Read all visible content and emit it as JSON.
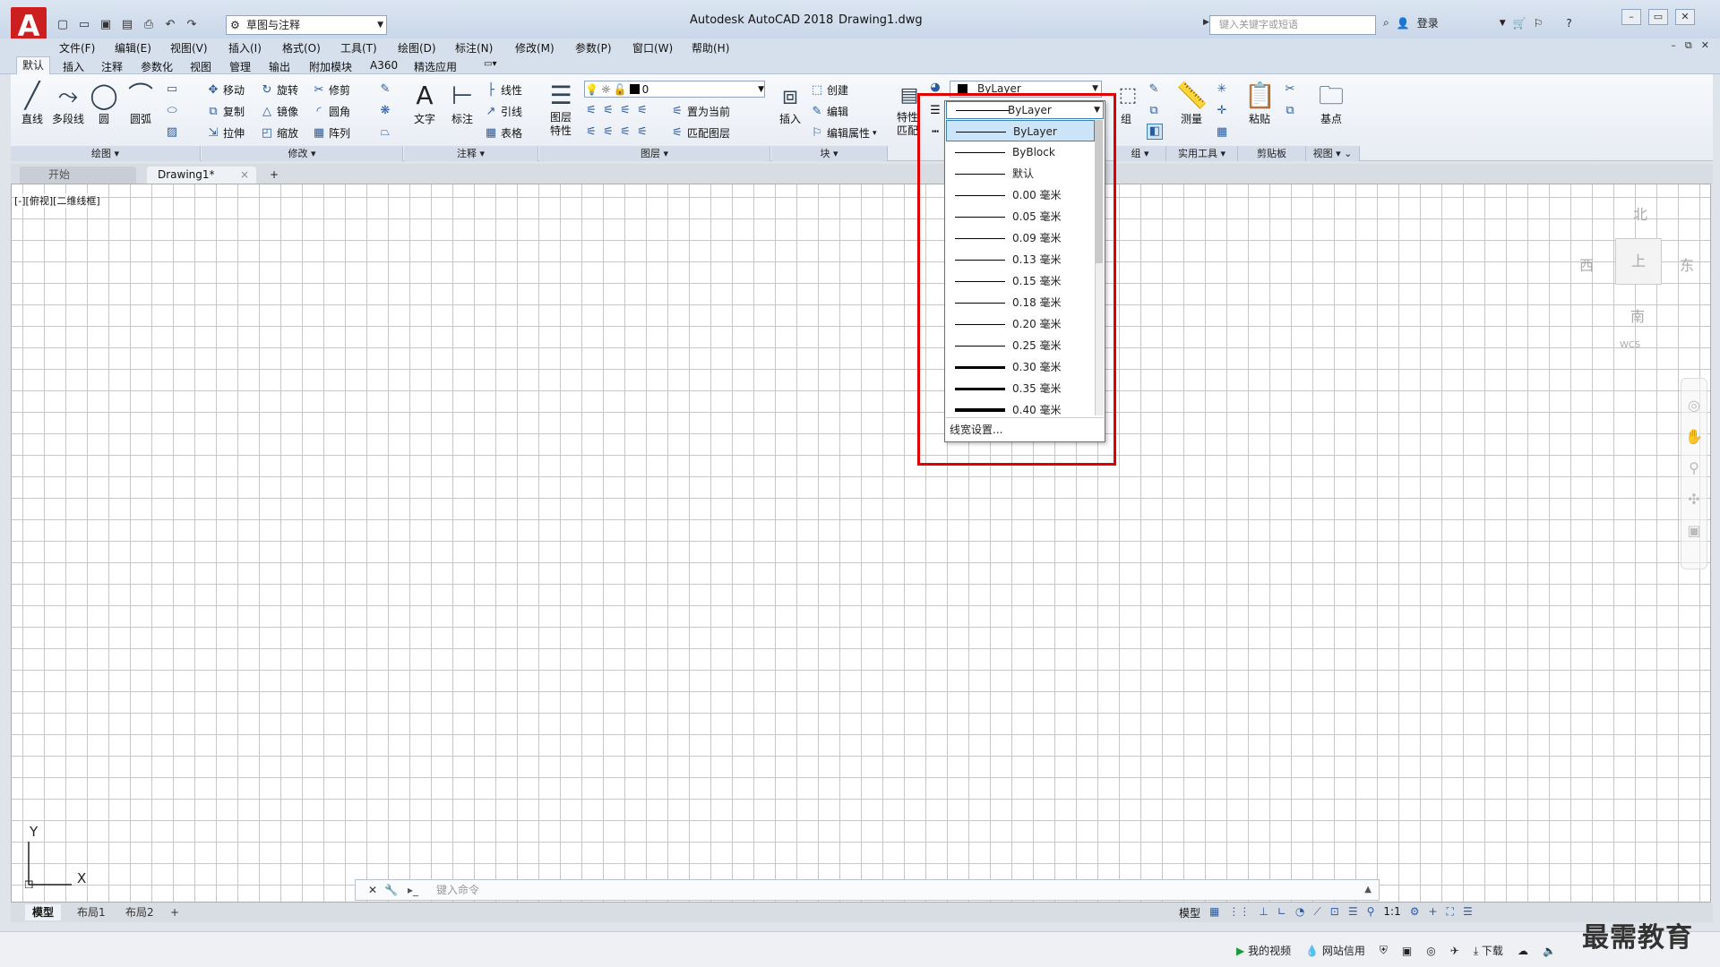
{
  "window": {
    "app_title": "Autodesk AutoCAD 2018",
    "doc_name": "Drawing1.dwg",
    "logo_letter": "A"
  },
  "workspace": {
    "value": "草图与注释"
  },
  "search": {
    "placeholder": "键入关键字或短语",
    "login": "登录"
  },
  "menu": [
    "文件(F)",
    "编辑(E)",
    "视图(V)",
    "插入(I)",
    "格式(O)",
    "工具(T)",
    "绘图(D)",
    "标注(N)",
    "修改(M)",
    "参数(P)",
    "窗口(W)",
    "帮助(H)"
  ],
  "ribbon_tabs": [
    "默认",
    "插入",
    "注释",
    "参数化",
    "视图",
    "管理",
    "输出",
    "附加模块",
    "A360",
    "精选应用"
  ],
  "panels": {
    "draw": {
      "title": "绘图",
      "tools": [
        "直线",
        "多段线",
        "圆",
        "圆弧"
      ]
    },
    "modify": {
      "title": "修改",
      "tools": [
        "移动",
        "旋转",
        "修剪",
        "复制",
        "镜像",
        "圆角",
        "拉伸",
        "缩放",
        "阵列"
      ]
    },
    "annotation": {
      "title": "注释",
      "tools": [
        "文字",
        "标注",
        "线性",
        "引线",
        "表格"
      ]
    },
    "layers": {
      "title": "图层",
      "tools": [
        "图层特性",
        "置为当前",
        "匹配图层"
      ],
      "layer_value": "0"
    },
    "block": {
      "title": "块",
      "tools": [
        "插入",
        "创建",
        "编辑",
        "编辑属性"
      ]
    },
    "properties": {
      "tools": [
        "特性",
        "匹配"
      ],
      "color_value": "ByLayer"
    },
    "groups": {
      "title": "组",
      "tools": [
        "组"
      ]
    },
    "utilities": {
      "title": "实用工具",
      "tools": [
        "测量"
      ]
    },
    "clipboard": {
      "title": "剪贴板",
      "tools": [
        "粘贴"
      ]
    },
    "view": {
      "title": "视图",
      "tools": [
        "基点"
      ]
    }
  },
  "doc_tabs": [
    "开始",
    "Drawing1*"
  ],
  "viewport_label": "[-][俯视][二维线框]",
  "viewcube": {
    "n": "北",
    "s": "南",
    "e": "东",
    "w": "西",
    "top": "上",
    "wcs": "WCS"
  },
  "ucs": {
    "x": "X",
    "y": "Y"
  },
  "command": {
    "placeholder": "键入命令"
  },
  "layout_tabs": [
    "模型",
    "布局1",
    "布局2"
  ],
  "status": {
    "model": "模型",
    "scale": "1:1"
  },
  "lineweight_dropdown": {
    "current": "ByLayer",
    "items": [
      {
        "label": "ByLayer",
        "weight": 1,
        "selected": true
      },
      {
        "label": "ByBlock",
        "weight": 1
      },
      {
        "label": "默认",
        "weight": 1
      },
      {
        "label": "0.00 毫米",
        "weight": 1
      },
      {
        "label": "0.05 毫米",
        "weight": 1
      },
      {
        "label": "0.09 毫米",
        "weight": 1
      },
      {
        "label": "0.13 毫米",
        "weight": 1
      },
      {
        "label": "0.15 毫米",
        "weight": 1
      },
      {
        "label": "0.18 毫米",
        "weight": 1
      },
      {
        "label": "0.20 毫米",
        "weight": 1
      },
      {
        "label": "0.25 毫米",
        "weight": 1
      },
      {
        "label": "0.30 毫米",
        "weight": 3
      },
      {
        "label": "0.35 毫米",
        "weight": 3
      },
      {
        "label": "0.40 毫米",
        "weight": 4
      }
    ],
    "footer": "线宽设置..."
  },
  "taskbar": {
    "items": [
      "我的视频",
      "网站信用",
      "下载"
    ]
  },
  "watermark": "最需教育",
  "colors": {
    "highlight": "#e00000",
    "selection": "#cce4f7",
    "logo": "#cc1f1f"
  }
}
